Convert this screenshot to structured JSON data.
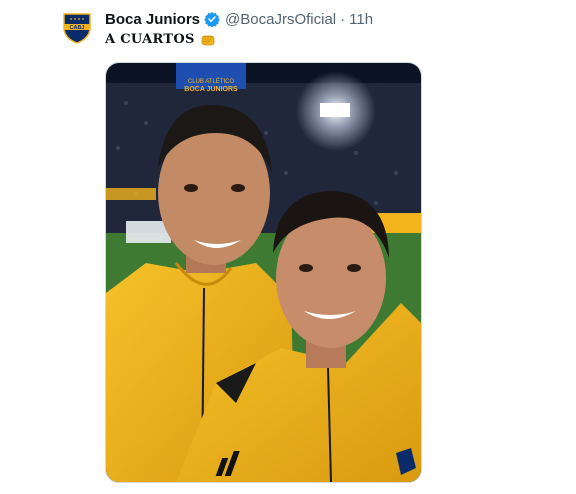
{
  "tweet": {
    "author_name": "Boca Juniors",
    "handle": "@BocaJrsOficial",
    "separator": "·",
    "time": "11h",
    "text": "A CUARTOS",
    "emoji_icon": "raised-fist-icon",
    "verified_icon": "verified-badge-icon",
    "avatar_crest_text": "CABJ",
    "photo": {
      "stadium_sign_line1": "CLUB ATLÉTICO",
      "stadium_sign_line2": "BOCA JUNIORS"
    }
  },
  "colors": {
    "verified_blue": "#1d9bf0",
    "boca_blue": "#0b2c6b",
    "boca_gold": "#f3b41b",
    "jacket_yellow": "#f2b51c",
    "muted_text": "#536471"
  }
}
